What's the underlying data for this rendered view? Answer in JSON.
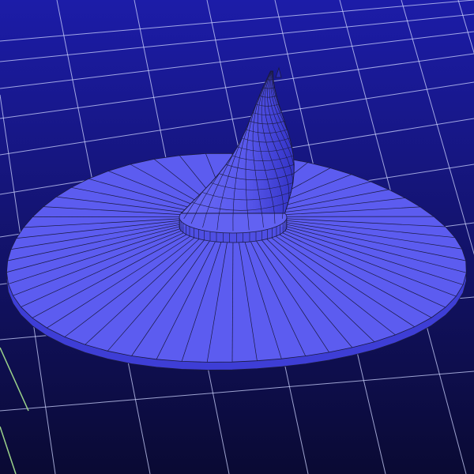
{
  "viewport": {
    "background_top": "#1c1ca8",
    "background_bottom": "#0a0a33",
    "grid_color": "#cfd6ff",
    "axis_color": "#9bd28a",
    "model_color": "#5c5cf0",
    "model_shade": "#3e3ed6",
    "wire_color": "#1a1a40"
  }
}
